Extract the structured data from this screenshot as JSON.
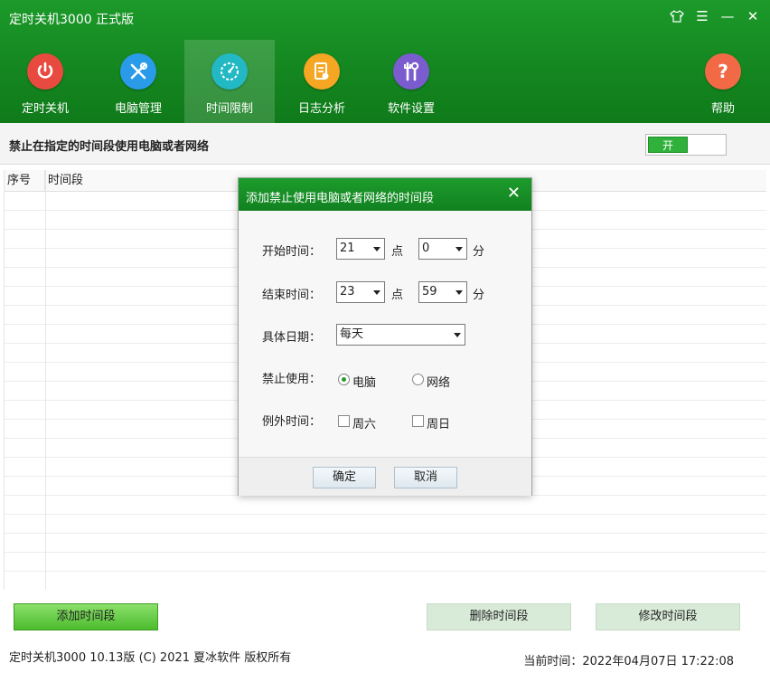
{
  "app": {
    "title": "定时关机3000 正式版"
  },
  "nav": [
    {
      "label": "定时关机",
      "color": "#e94a3f"
    },
    {
      "label": "电脑管理",
      "color": "#2a9be8"
    },
    {
      "label": "时间限制",
      "color": "#22b8c4"
    },
    {
      "label": "日志分析",
      "color": "#f5a623"
    },
    {
      "label": "软件设置",
      "color": "#7a5ccf"
    },
    {
      "label": "帮助",
      "color": "#f26a45"
    }
  ],
  "section": {
    "title": "禁止在指定的时间段使用电脑或者网络",
    "toggle_label": "开"
  },
  "table": {
    "col_index": "序号",
    "col_period": "时间段"
  },
  "buttons": {
    "add": "添加时间段",
    "delete": "删除时间段",
    "modify": "修改时间段"
  },
  "footer": {
    "copyright": "定时关机3000 10.13版 (C) 2021  夏冰软件 版权所有",
    "current_time": "当前时间：2022年04月07日 17:22:08"
  },
  "dialog": {
    "title": "添加禁止使用电脑或者网络的时间段",
    "close_glyph": "✕",
    "start_label": "开始时间：",
    "start_hour": "21",
    "start_minute": "0",
    "end_label": "结束时间：",
    "end_hour": "23",
    "end_minute": "59",
    "hour_unit": "点",
    "minute_unit": "分",
    "date_label": "具体日期：",
    "date_value": "每天",
    "forbid_label": "禁止使用：",
    "forbid_computer": "电脑",
    "forbid_network": "网络",
    "except_label": "例外时间：",
    "except_sat": "周六",
    "except_sun": "周日",
    "ok": "确定",
    "cancel": "取消"
  }
}
